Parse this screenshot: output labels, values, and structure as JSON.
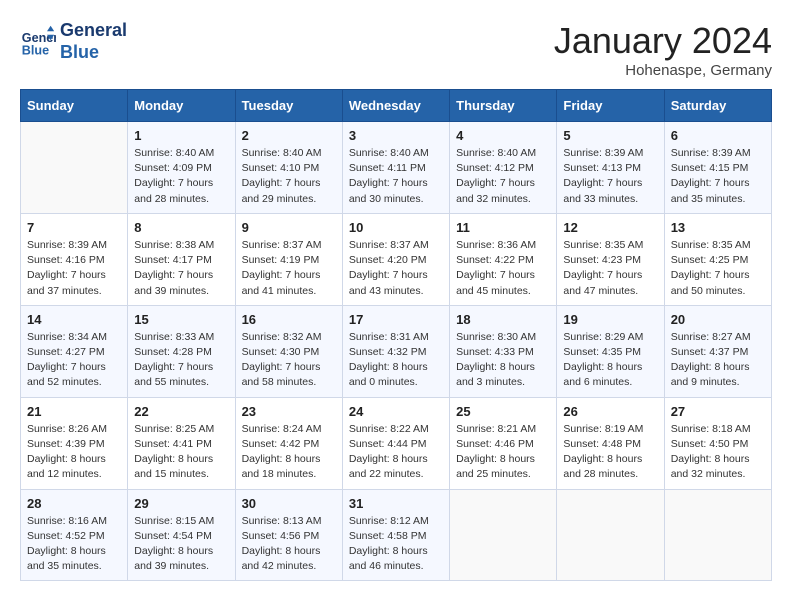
{
  "header": {
    "logo_line1": "General",
    "logo_line2": "Blue",
    "month": "January 2024",
    "location": "Hohenaspe, Germany"
  },
  "weekdays": [
    "Sunday",
    "Monday",
    "Tuesday",
    "Wednesday",
    "Thursday",
    "Friday",
    "Saturday"
  ],
  "weeks": [
    [
      {
        "day": "",
        "sunrise": "",
        "sunset": "",
        "daylight": ""
      },
      {
        "day": "1",
        "sunrise": "Sunrise: 8:40 AM",
        "sunset": "Sunset: 4:09 PM",
        "daylight": "Daylight: 7 hours and 28 minutes."
      },
      {
        "day": "2",
        "sunrise": "Sunrise: 8:40 AM",
        "sunset": "Sunset: 4:10 PM",
        "daylight": "Daylight: 7 hours and 29 minutes."
      },
      {
        "day": "3",
        "sunrise": "Sunrise: 8:40 AM",
        "sunset": "Sunset: 4:11 PM",
        "daylight": "Daylight: 7 hours and 30 minutes."
      },
      {
        "day": "4",
        "sunrise": "Sunrise: 8:40 AM",
        "sunset": "Sunset: 4:12 PM",
        "daylight": "Daylight: 7 hours and 32 minutes."
      },
      {
        "day": "5",
        "sunrise": "Sunrise: 8:39 AM",
        "sunset": "Sunset: 4:13 PM",
        "daylight": "Daylight: 7 hours and 33 minutes."
      },
      {
        "day": "6",
        "sunrise": "Sunrise: 8:39 AM",
        "sunset": "Sunset: 4:15 PM",
        "daylight": "Daylight: 7 hours and 35 minutes."
      }
    ],
    [
      {
        "day": "7",
        "sunrise": "Sunrise: 8:39 AM",
        "sunset": "Sunset: 4:16 PM",
        "daylight": "Daylight: 7 hours and 37 minutes."
      },
      {
        "day": "8",
        "sunrise": "Sunrise: 8:38 AM",
        "sunset": "Sunset: 4:17 PM",
        "daylight": "Daylight: 7 hours and 39 minutes."
      },
      {
        "day": "9",
        "sunrise": "Sunrise: 8:37 AM",
        "sunset": "Sunset: 4:19 PM",
        "daylight": "Daylight: 7 hours and 41 minutes."
      },
      {
        "day": "10",
        "sunrise": "Sunrise: 8:37 AM",
        "sunset": "Sunset: 4:20 PM",
        "daylight": "Daylight: 7 hours and 43 minutes."
      },
      {
        "day": "11",
        "sunrise": "Sunrise: 8:36 AM",
        "sunset": "Sunset: 4:22 PM",
        "daylight": "Daylight: 7 hours and 45 minutes."
      },
      {
        "day": "12",
        "sunrise": "Sunrise: 8:35 AM",
        "sunset": "Sunset: 4:23 PM",
        "daylight": "Daylight: 7 hours and 47 minutes."
      },
      {
        "day": "13",
        "sunrise": "Sunrise: 8:35 AM",
        "sunset": "Sunset: 4:25 PM",
        "daylight": "Daylight: 7 hours and 50 minutes."
      }
    ],
    [
      {
        "day": "14",
        "sunrise": "Sunrise: 8:34 AM",
        "sunset": "Sunset: 4:27 PM",
        "daylight": "Daylight: 7 hours and 52 minutes."
      },
      {
        "day": "15",
        "sunrise": "Sunrise: 8:33 AM",
        "sunset": "Sunset: 4:28 PM",
        "daylight": "Daylight: 7 hours and 55 minutes."
      },
      {
        "day": "16",
        "sunrise": "Sunrise: 8:32 AM",
        "sunset": "Sunset: 4:30 PM",
        "daylight": "Daylight: 7 hours and 58 minutes."
      },
      {
        "day": "17",
        "sunrise": "Sunrise: 8:31 AM",
        "sunset": "Sunset: 4:32 PM",
        "daylight": "Daylight: 8 hours and 0 minutes."
      },
      {
        "day": "18",
        "sunrise": "Sunrise: 8:30 AM",
        "sunset": "Sunset: 4:33 PM",
        "daylight": "Daylight: 8 hours and 3 minutes."
      },
      {
        "day": "19",
        "sunrise": "Sunrise: 8:29 AM",
        "sunset": "Sunset: 4:35 PM",
        "daylight": "Daylight: 8 hours and 6 minutes."
      },
      {
        "day": "20",
        "sunrise": "Sunrise: 8:27 AM",
        "sunset": "Sunset: 4:37 PM",
        "daylight": "Daylight: 8 hours and 9 minutes."
      }
    ],
    [
      {
        "day": "21",
        "sunrise": "Sunrise: 8:26 AM",
        "sunset": "Sunset: 4:39 PM",
        "daylight": "Daylight: 8 hours and 12 minutes."
      },
      {
        "day": "22",
        "sunrise": "Sunrise: 8:25 AM",
        "sunset": "Sunset: 4:41 PM",
        "daylight": "Daylight: 8 hours and 15 minutes."
      },
      {
        "day": "23",
        "sunrise": "Sunrise: 8:24 AM",
        "sunset": "Sunset: 4:42 PM",
        "daylight": "Daylight: 8 hours and 18 minutes."
      },
      {
        "day": "24",
        "sunrise": "Sunrise: 8:22 AM",
        "sunset": "Sunset: 4:44 PM",
        "daylight": "Daylight: 8 hours and 22 minutes."
      },
      {
        "day": "25",
        "sunrise": "Sunrise: 8:21 AM",
        "sunset": "Sunset: 4:46 PM",
        "daylight": "Daylight: 8 hours and 25 minutes."
      },
      {
        "day": "26",
        "sunrise": "Sunrise: 8:19 AM",
        "sunset": "Sunset: 4:48 PM",
        "daylight": "Daylight: 8 hours and 28 minutes."
      },
      {
        "day": "27",
        "sunrise": "Sunrise: 8:18 AM",
        "sunset": "Sunset: 4:50 PM",
        "daylight": "Daylight: 8 hours and 32 minutes."
      }
    ],
    [
      {
        "day": "28",
        "sunrise": "Sunrise: 8:16 AM",
        "sunset": "Sunset: 4:52 PM",
        "daylight": "Daylight: 8 hours and 35 minutes."
      },
      {
        "day": "29",
        "sunrise": "Sunrise: 8:15 AM",
        "sunset": "Sunset: 4:54 PM",
        "daylight": "Daylight: 8 hours and 39 minutes."
      },
      {
        "day": "30",
        "sunrise": "Sunrise: 8:13 AM",
        "sunset": "Sunset: 4:56 PM",
        "daylight": "Daylight: 8 hours and 42 minutes."
      },
      {
        "day": "31",
        "sunrise": "Sunrise: 8:12 AM",
        "sunset": "Sunset: 4:58 PM",
        "daylight": "Daylight: 8 hours and 46 minutes."
      },
      {
        "day": "",
        "sunrise": "",
        "sunset": "",
        "daylight": ""
      },
      {
        "day": "",
        "sunrise": "",
        "sunset": "",
        "daylight": ""
      },
      {
        "day": "",
        "sunrise": "",
        "sunset": "",
        "daylight": ""
      }
    ]
  ]
}
